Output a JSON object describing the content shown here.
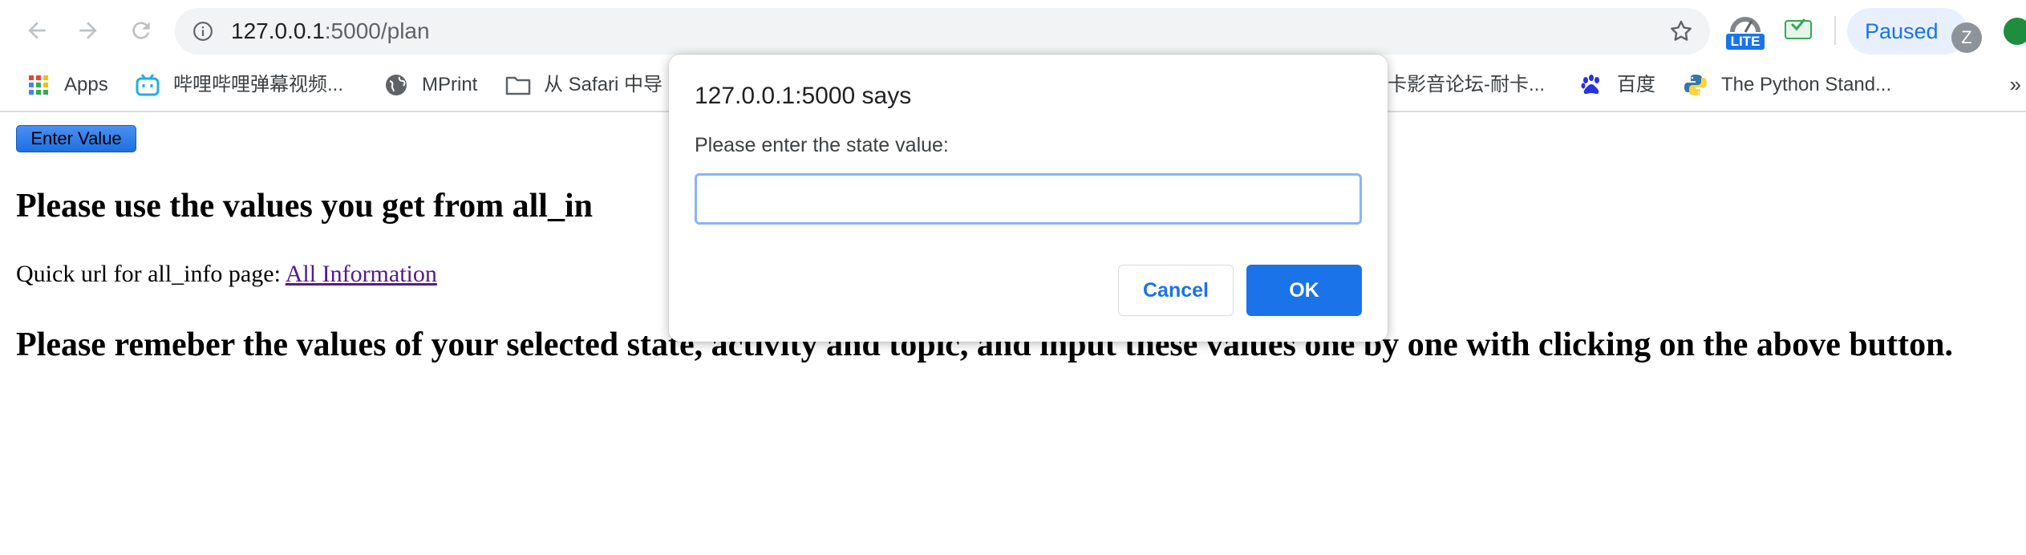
{
  "browser": {
    "url_host": "127.0.0.1",
    "url_path": ":5000/plan",
    "extensions": [
      "lite-extension",
      "mail-extension"
    ],
    "lite_badge": "LITE",
    "profile": {
      "status_label": "Paused",
      "avatar_initial": "Z"
    }
  },
  "bookmarks": [
    {
      "icon": "apps-grid-icon",
      "label": "Apps"
    },
    {
      "icon": "bilibili-icon",
      "label": "哔哩哔哩弹幕视频..."
    },
    {
      "icon": "globe-icon",
      "label": "MPrint"
    },
    {
      "icon": "folder-icon",
      "label": "从 Safari 中导"
    },
    {
      "icon": "",
      "label": "卡影音论坛-耐卡..."
    },
    {
      "icon": "baidu-paw-icon",
      "label": "百度"
    },
    {
      "icon": "python-icon",
      "label": "The Python Stand..."
    }
  ],
  "bookmarks_more": "»",
  "page": {
    "enter_button": "Enter Value",
    "heading1": "Please use the values you get from all_in",
    "quick_prefix": "Quick url for all_info page: ",
    "quick_link": "All Information",
    "heading2": "Please remeber the values of your selected state, activity and topic, and input these values one by one with clicking on the above button."
  },
  "dialog": {
    "title": "127.0.0.1:5000 says",
    "message": "Please enter the state value:",
    "input_value": "",
    "cancel_label": "Cancel",
    "ok_label": "OK"
  }
}
